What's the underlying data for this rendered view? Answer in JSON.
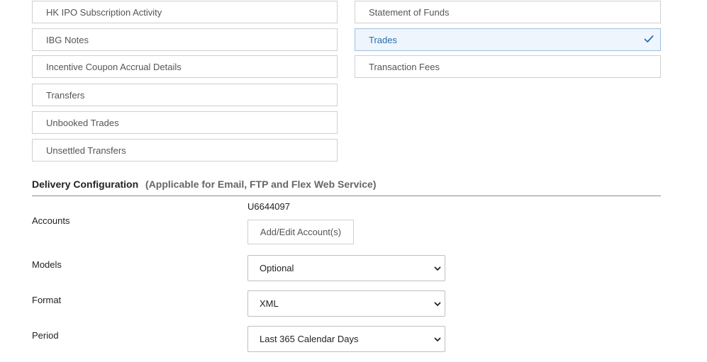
{
  "sections": {
    "left": [
      {
        "label": "HK IPO Subscription Activity"
      },
      {
        "label": "IBG Notes"
      },
      {
        "label": "Incentive Coupon Accrual Details"
      },
      {
        "label": "Transfers"
      },
      {
        "label": "Unbooked Trades"
      },
      {
        "label": "Unsettled Transfers"
      }
    ],
    "right": [
      {
        "label": "Statement of Funds",
        "selected": false
      },
      {
        "label": "Trades",
        "selected": true
      },
      {
        "label": "Transaction Fees",
        "selected": false
      }
    ]
  },
  "delivery": {
    "title": "Delivery Configuration",
    "subtitle": "(Applicable for Email, FTP and Flex Web Service)"
  },
  "accounts": {
    "label": "Accounts",
    "value": "U6644097",
    "button_label": "Add/Edit Account(s)"
  },
  "models": {
    "label": "Models",
    "value": "Optional"
  },
  "format": {
    "label": "Format",
    "value": "XML"
  },
  "period": {
    "label": "Period",
    "value": "Last 365 Calendar Days"
  },
  "icons": {
    "selected_check": "check-icon",
    "dropdown": "chevron-down-icon"
  },
  "colors": {
    "selected_bg": "#eef5fc",
    "selected_text": "#2b6cb0",
    "border": "#cfcfcf"
  }
}
